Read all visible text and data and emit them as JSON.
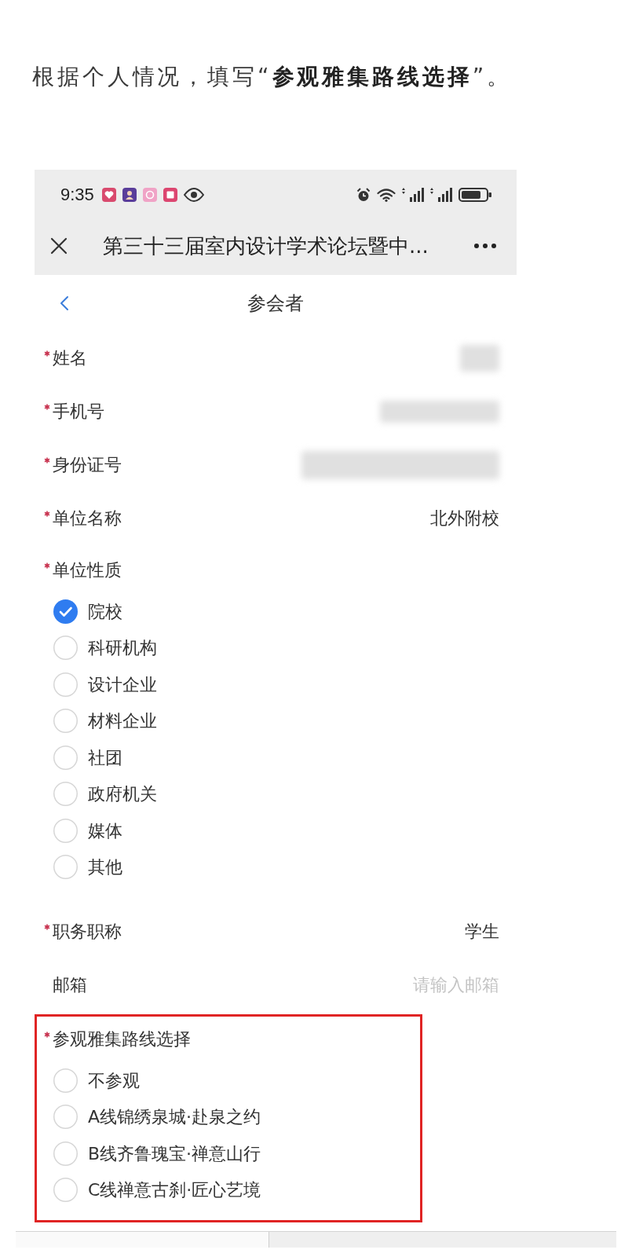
{
  "instruction": "根据个人情况，填写“**参观雅集路线选择**”。",
  "status_bar": {
    "time": "9:35"
  },
  "title_bar": {
    "title": "第三十三届室内设计学术论坛暨中..."
  },
  "nav_bar": {
    "title": "参会者"
  },
  "fields": [
    {
      "kind": "text",
      "label": "姓名",
      "required": true,
      "highlighted": false,
      "blurred": true
    },
    {
      "kind": "text",
      "label": "手机号",
      "required": true,
      "highlighted": false,
      "blurred": true
    },
    {
      "kind": "text",
      "label": "身份证号",
      "required": true,
      "highlighted": false,
      "blurred": true
    },
    {
      "kind": "text",
      "label": "单位名称",
      "required": true,
      "highlighted": false,
      "blurred": false,
      "value": "北外附校"
    },
    {
      "kind": "radio",
      "label": "单位性质",
      "required": true,
      "highlighted": false,
      "options": [
        {
          "label": "院校",
          "selected": true
        },
        {
          "label": "科研机构",
          "selected": false
        },
        {
          "label": "设计企业",
          "selected": false
        },
        {
          "label": "材料企业",
          "selected": false
        },
        {
          "label": "社团",
          "selected": false
        },
        {
          "label": "政府机关",
          "selected": false
        },
        {
          "label": "媒体",
          "selected": false
        },
        {
          "label": "其他",
          "selected": false
        }
      ]
    },
    {
      "kind": "text",
      "label": "职务职称",
      "required": true,
      "highlighted": false,
      "blurred": false,
      "value": "学生"
    },
    {
      "kind": "text",
      "label": "邮箱",
      "required": false,
      "highlighted": false,
      "blurred": false,
      "placeholder": "请输入邮箱"
    },
    {
      "kind": "radio",
      "label": "参观雅集路线选择",
      "required": true,
      "highlighted": true,
      "options": [
        {
          "label": "不参观",
          "selected": false
        },
        {
          "label": "A线锦绣泉城·赴泉之约",
          "selected": false
        },
        {
          "label": "B线齐鲁瑰宝·禅意山行",
          "selected": false
        },
        {
          "label": "C线禅意古刹·匠心艺境",
          "selected": false
        }
      ]
    }
  ]
}
